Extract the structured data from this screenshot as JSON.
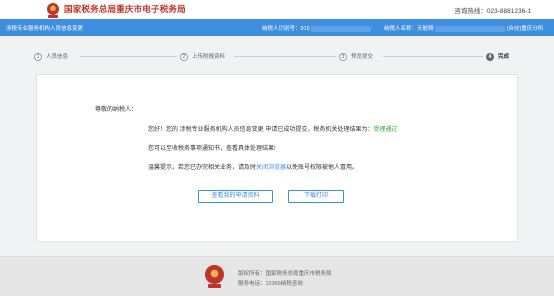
{
  "header": {
    "site_title": "国家税务总局重庆市电子税务局",
    "hotline": "咨询热线：023-8881236-1"
  },
  "infobar": {
    "service_name": "涉税专业服务机构人员信息变更",
    "taxpayer_id_label": "纳税人识别号：",
    "taxpayer_id_value": "915",
    "taxpayer_name_label": "纳税人名称：",
    "taxpayer_name_value": "天航翔",
    "taxpayer_name_suffix": "(合伙)重庆分所"
  },
  "steps": [
    {
      "number": "1",
      "label": "人员信息"
    },
    {
      "number": "2",
      "label": "上传附报资料"
    },
    {
      "number": "3",
      "label": "预览提交"
    },
    {
      "number": "4",
      "label": "完成"
    }
  ],
  "result": {
    "greeting": "尊敬的纳税人：",
    "line1_prefix": "您好！您的 涉税专业服务机构人员信息变更 申请已成功提交，税务机关处理结果为：",
    "line1_result": "受理通过",
    "line2": "您可以至收税务事项通知书，查看具体处理结果!",
    "line3_prefix": "温馨提示，若您已办完相关业务，请及时",
    "line3_link": "关闭浏览器",
    "line3_suffix": "以免账号权限被他人冒用。"
  },
  "buttons": {
    "view_application": "查看我的申请资料",
    "download_print": "下载打印"
  },
  "footer": {
    "host": "版权所有：国家税务总局重庆市税务局",
    "service_phone": "服务电话：12366纳税咨询"
  },
  "colors": {
    "brand_red": "#c0332b",
    "infobar_blue": "#3e8fe0",
    "success_green": "#3aa23a"
  }
}
